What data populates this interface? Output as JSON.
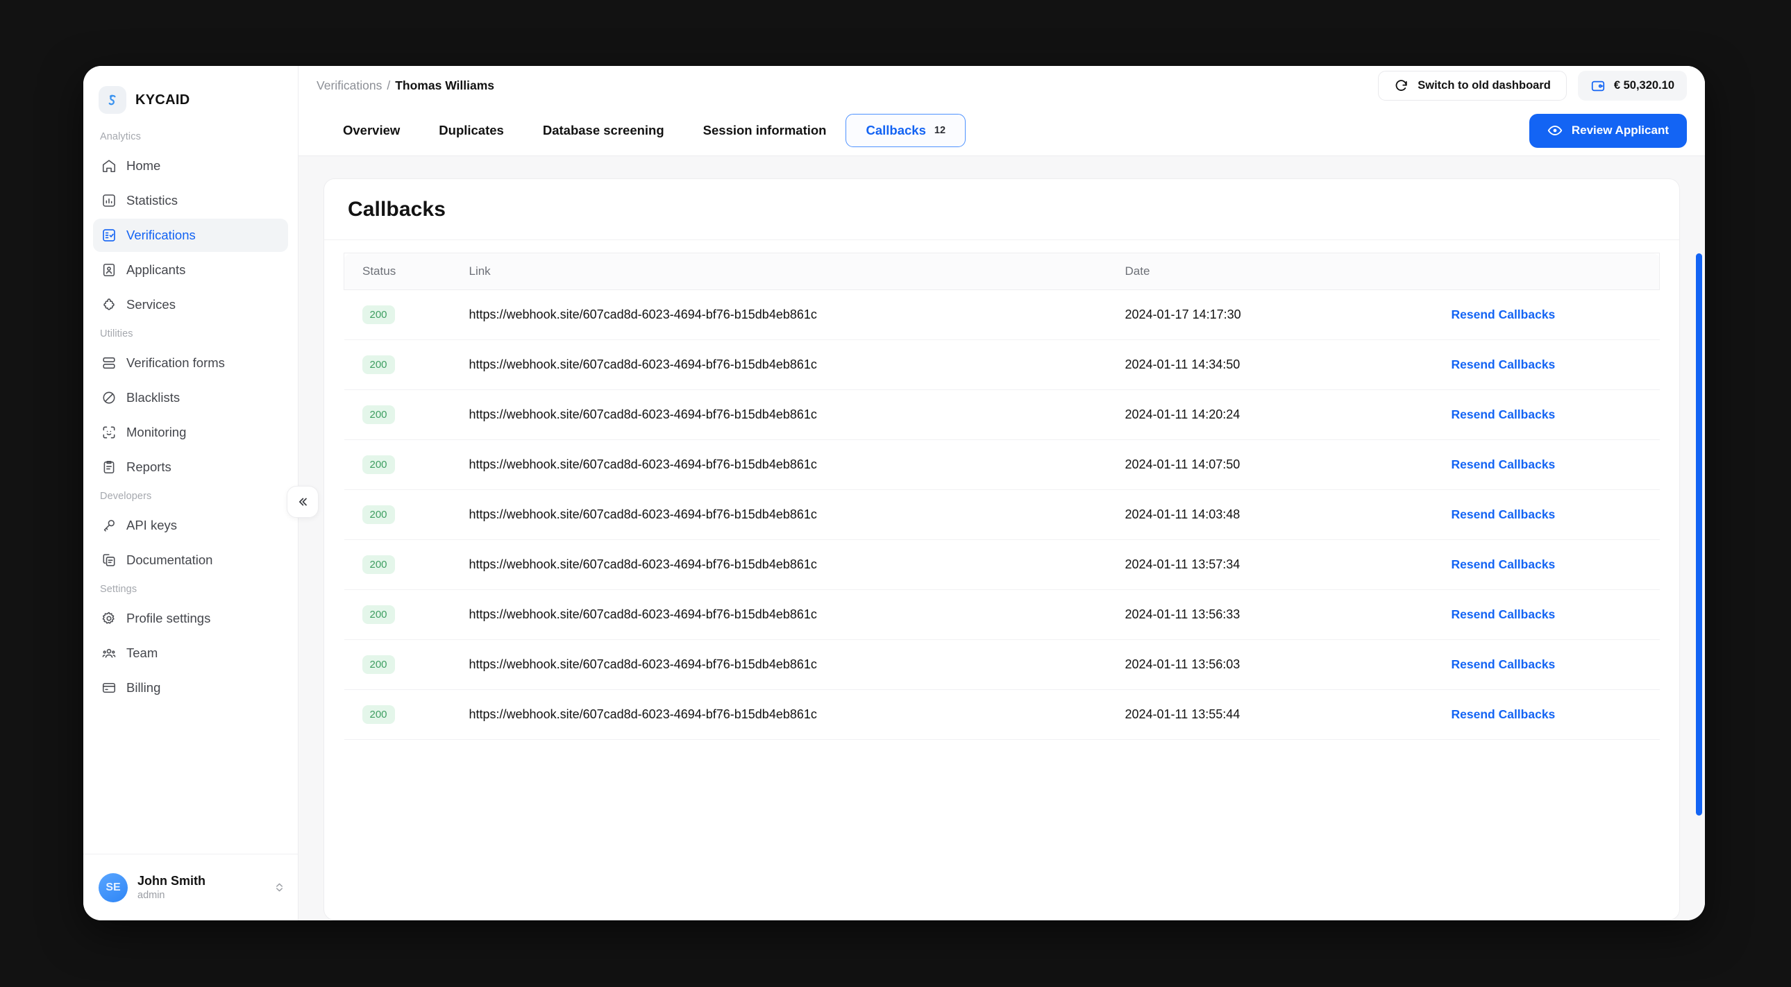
{
  "brand": {
    "name": "KYCAID",
    "logo_icon": "kycaid-swirl-icon"
  },
  "sidebar": {
    "groups": [
      {
        "label": "Analytics",
        "items": [
          {
            "label": "Home",
            "icon": "home-icon",
            "active": false
          },
          {
            "label": "Statistics",
            "icon": "chart-square-icon",
            "active": false
          },
          {
            "label": "Verifications",
            "icon": "checklist-icon",
            "active": true
          },
          {
            "label": "Applicants",
            "icon": "id-card-icon",
            "active": false
          },
          {
            "label": "Services",
            "icon": "puzzle-icon",
            "active": false
          }
        ]
      },
      {
        "label": "Utilities",
        "items": [
          {
            "label": "Verification forms",
            "icon": "rows-icon",
            "active": false
          },
          {
            "label": "Blacklists",
            "icon": "ban-icon",
            "active": false
          },
          {
            "label": "Monitoring",
            "icon": "face-scan-icon",
            "active": false
          },
          {
            "label": "Reports",
            "icon": "clipboard-icon",
            "active": false
          }
        ]
      },
      {
        "label": "Developers",
        "items": [
          {
            "label": "API keys",
            "icon": "key-icon",
            "active": false
          },
          {
            "label": "Documentation",
            "icon": "documents-icon",
            "active": false
          }
        ]
      },
      {
        "label": "Settings",
        "items": [
          {
            "label": "Profile settings",
            "icon": "gear-icon",
            "active": false
          },
          {
            "label": "Team",
            "icon": "people-icon",
            "active": false
          },
          {
            "label": "Billing",
            "icon": "credit-card-icon",
            "active": false
          }
        ]
      }
    ],
    "collapse_icon": "chevron-double-left-icon",
    "user": {
      "initials": "SE",
      "name": "John Smith",
      "role": "admin"
    }
  },
  "topbar": {
    "breadcrumb_parent": "Verifications",
    "breadcrumb_separator": "/",
    "breadcrumb_current": "Thomas Williams",
    "switch_dashboard_label": "Switch to old dashboard",
    "switch_dashboard_icon": "refresh-icon",
    "balance": "€ 50,320.10",
    "balance_icon": "wallet-icon"
  },
  "tabs": [
    {
      "label": "Overview",
      "count": "",
      "active": false
    },
    {
      "label": "Duplicates",
      "count": "",
      "active": false
    },
    {
      "label": "Database screening",
      "count": "",
      "active": false
    },
    {
      "label": "Session information",
      "count": "",
      "active": false
    },
    {
      "label": "Callbacks",
      "count": "12",
      "active": true
    }
  ],
  "review_button": {
    "label": "Review Applicant",
    "icon": "eye-icon",
    "color": "#1364f4"
  },
  "card": {
    "title": "Callbacks",
    "columns": [
      "Status",
      "Link",
      "Date",
      ""
    ],
    "action_label": "Resend Callbacks",
    "rows": [
      {
        "status": "200",
        "link": "https://webhook.site/607cad8d-6023-4694-bf76-b15db4eb861c",
        "date": "2024-01-17 14:17:30",
        "action": "Resend Callbacks"
      },
      {
        "status": "200",
        "link": "https://webhook.site/607cad8d-6023-4694-bf76-b15db4eb861c",
        "date": "2024-01-11 14:34:50",
        "action": "Resend Callbacks"
      },
      {
        "status": "200",
        "link": "https://webhook.site/607cad8d-6023-4694-bf76-b15db4eb861c",
        "date": "2024-01-11 14:20:24",
        "action": "Resend Callbacks"
      },
      {
        "status": "200",
        "link": "https://webhook.site/607cad8d-6023-4694-bf76-b15db4eb861c",
        "date": "2024-01-11 14:07:50",
        "action": "Resend Callbacks"
      },
      {
        "status": "200",
        "link": "https://webhook.site/607cad8d-6023-4694-bf76-b15db4eb861c",
        "date": "2024-01-11 14:03:48",
        "action": "Resend Callbacks"
      },
      {
        "status": "200",
        "link": "https://webhook.site/607cad8d-6023-4694-bf76-b15db4eb861c",
        "date": "2024-01-11 13:57:34",
        "action": "Resend Callbacks"
      },
      {
        "status": "200",
        "link": "https://webhook.site/607cad8d-6023-4694-bf76-b15db4eb861c",
        "date": "2024-01-11 13:56:33",
        "action": "Resend Callbacks"
      },
      {
        "status": "200",
        "link": "https://webhook.site/607cad8d-6023-4694-bf76-b15db4eb861c",
        "date": "2024-01-11 13:56:03",
        "action": "Resend Callbacks"
      },
      {
        "status": "200",
        "link": "https://webhook.site/607cad8d-6023-4694-bf76-b15db4eb861c",
        "date": "2024-01-11 13:55:44",
        "action": "Resend Callbacks"
      }
    ]
  },
  "colors": {
    "accent": "#1364f4",
    "status_badge_bg": "#e4f6ea",
    "status_badge_fg": "#3f9f62",
    "page_bg": "#121212"
  }
}
